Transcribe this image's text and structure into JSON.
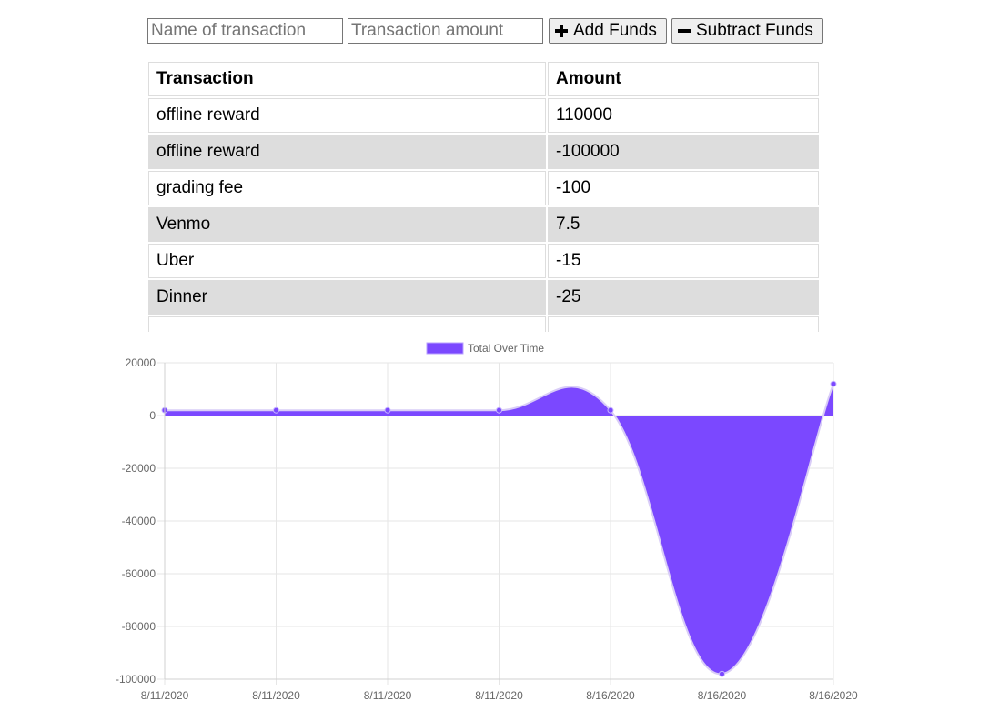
{
  "form": {
    "name_placeholder": "Name of transaction",
    "amount_placeholder": "Transaction amount",
    "add_label": "Add Funds",
    "subtract_label": "Subtract Funds"
  },
  "table": {
    "headers": [
      "Transaction",
      "Amount"
    ],
    "rows": [
      [
        "offline reward",
        "110000"
      ],
      [
        "offline reward",
        "-100000"
      ],
      [
        "grading fee",
        "-100"
      ],
      [
        "Venmo",
        "7.5"
      ],
      [
        "Uber",
        "-15"
      ],
      [
        "Dinner",
        "-25"
      ]
    ]
  },
  "chart_data": {
    "type": "area",
    "x": [
      "8/11/2020",
      "8/11/2020",
      "8/11/2020",
      "8/11/2020",
      "8/16/2020",
      "8/16/2020",
      "8/16/2020"
    ],
    "series": [
      {
        "name": "Total Over Time",
        "values": [
          2000,
          2000,
          2000,
          2000,
          2000,
          -98000,
          12000
        ],
        "color": "#7b48ff"
      }
    ],
    "ylim": [
      -100000,
      20000
    ],
    "yticks": [
      20000,
      0,
      -20000,
      -40000,
      -60000,
      -80000,
      -100000
    ],
    "ytick_labels": [
      "20000",
      "0",
      "-20000",
      "-40000",
      "-60000",
      "-80000",
      "-100000"
    ],
    "grid": true,
    "legend": "top"
  }
}
